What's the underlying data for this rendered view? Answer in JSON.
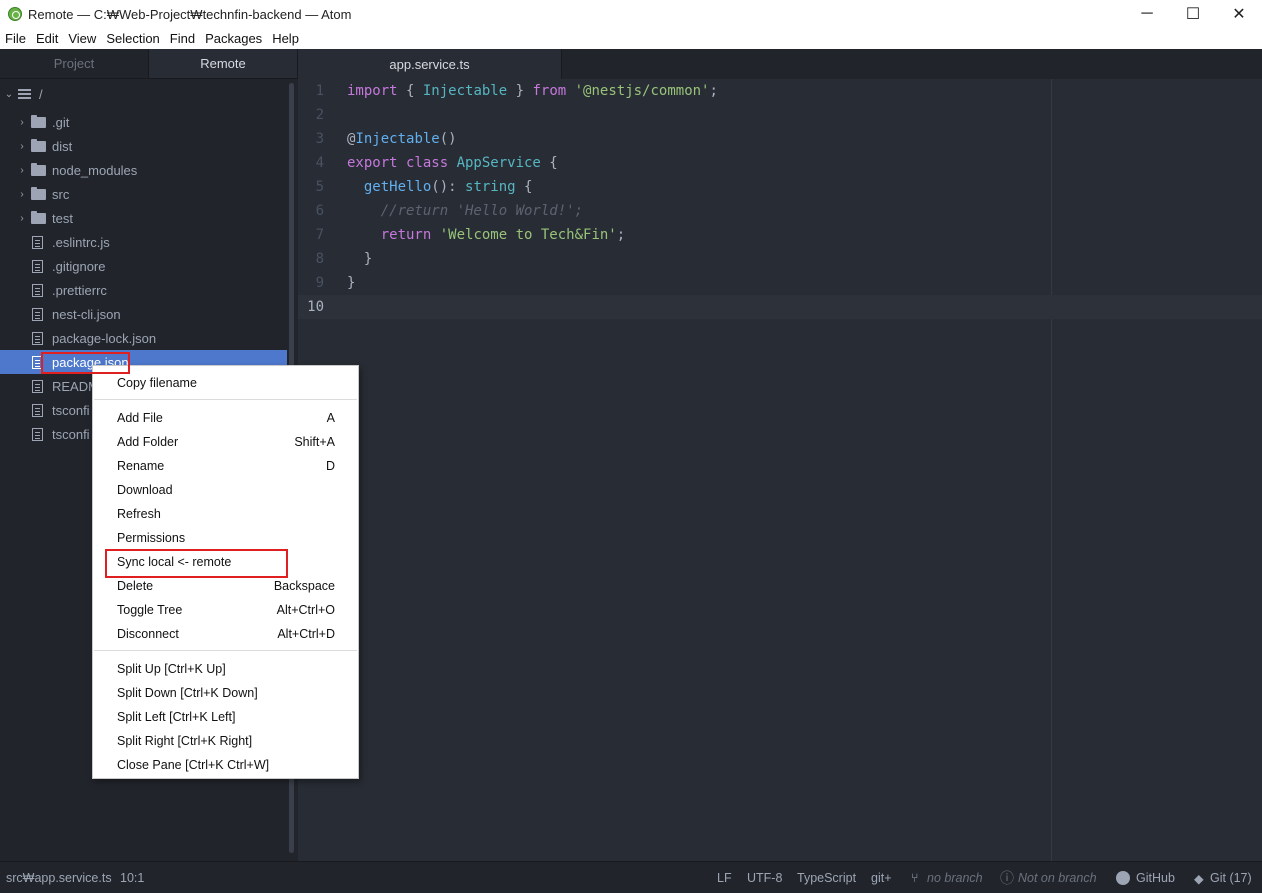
{
  "window": {
    "title": "Remote — C:₩Web-Project₩technfin-backend — Atom",
    "minimize": "─",
    "maximize": "☐",
    "close": "✕"
  },
  "menu": [
    "File",
    "Edit",
    "View",
    "Selection",
    "Find",
    "Packages",
    "Help"
  ],
  "tree": {
    "tabs": [
      "Project",
      "Remote"
    ],
    "active_tab": "Remote",
    "root_label": "/",
    "items": [
      {
        "label": ".git",
        "type": "folder"
      },
      {
        "label": "dist",
        "type": "folder"
      },
      {
        "label": "node_modules",
        "type": "folder"
      },
      {
        "label": "src",
        "type": "folder"
      },
      {
        "label": "test",
        "type": "folder"
      },
      {
        "label": ".eslintrc.js",
        "type": "file"
      },
      {
        "label": ".gitignore",
        "type": "file"
      },
      {
        "label": ".prettierrc",
        "type": "file"
      },
      {
        "label": "nest-cli.json",
        "type": "file"
      },
      {
        "label": "package-lock.json",
        "type": "file"
      },
      {
        "label": "package.json",
        "type": "file",
        "selected": true
      },
      {
        "label": "READM",
        "type": "file"
      },
      {
        "label": "tsconfi",
        "type": "file"
      },
      {
        "label": "tsconfi",
        "type": "file"
      }
    ]
  },
  "editor": {
    "tab": "app.service.ts",
    "line_numbers": [
      "1",
      "2",
      "3",
      "4",
      "5",
      "6",
      "7",
      "8",
      "9",
      "10"
    ],
    "cursor_line": 10
  },
  "context_menu": {
    "items": [
      {
        "label": "Copy filename",
        "shortcut": ""
      },
      {
        "label": "Add File",
        "shortcut": "A"
      },
      {
        "label": "Add Folder",
        "shortcut": "Shift+A"
      },
      {
        "label": "Rename",
        "shortcut": "D"
      },
      {
        "label": "Download",
        "shortcut": ""
      },
      {
        "label": "Refresh",
        "shortcut": ""
      },
      {
        "label": "Permissions",
        "shortcut": ""
      },
      {
        "label": "Sync local <- remote",
        "shortcut": "",
        "highlighted_by_annotation": true
      },
      {
        "label": "Delete",
        "shortcut": "Backspace"
      },
      {
        "label": "Toggle Tree",
        "shortcut": "Alt+Ctrl+O"
      },
      {
        "label": "Disconnect",
        "shortcut": "Alt+Ctrl+D"
      },
      {
        "label": "Split Up [Ctrl+K Up]",
        "shortcut": ""
      },
      {
        "label": "Split Down [Ctrl+K Down]",
        "shortcut": ""
      },
      {
        "label": "Split Left [Ctrl+K Left]",
        "shortcut": ""
      },
      {
        "label": "Split Right [Ctrl+K Right]",
        "shortcut": ""
      },
      {
        "label": "Close Pane [Ctrl+K Ctrl+W]",
        "shortcut": ""
      }
    ]
  },
  "status": {
    "path": "src₩app.service.ts",
    "position": "10:1",
    "line_ending": "LF",
    "encoding": "UTF-8",
    "grammar": "TypeScript",
    "git_plus": "git+",
    "branch": "no branch",
    "not_on_branch": "Not on branch",
    "github": "GitHub",
    "git": "Git (17)"
  },
  "colors": {
    "tree_bg": "#21252b",
    "editor_bg": "#282c34",
    "selection": "#4d78cc",
    "annotation_red": "#e02020"
  }
}
